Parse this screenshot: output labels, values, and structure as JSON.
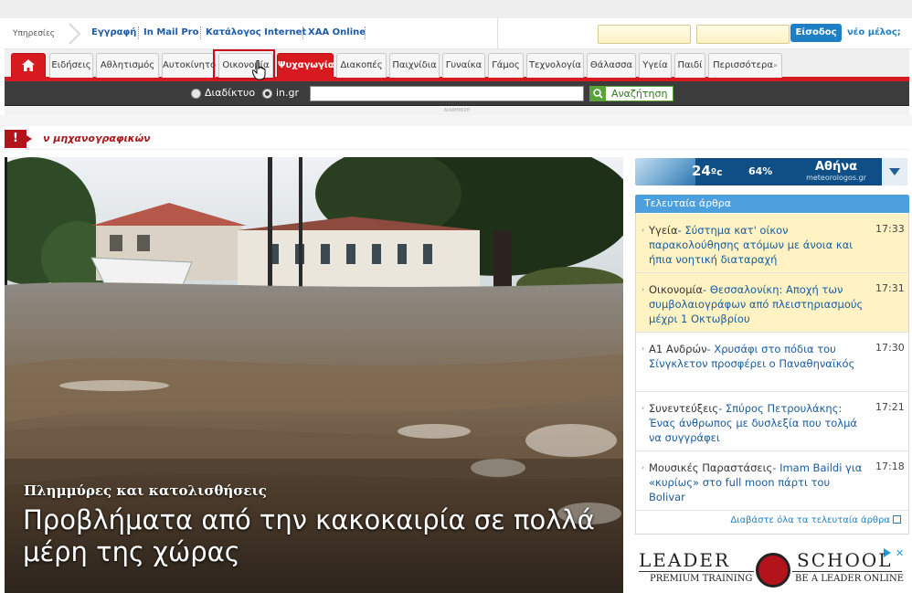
{
  "services_bar": {
    "label": "Υπηρεσίες",
    "links": [
      "Εγγραφή",
      "In Mail Pro",
      "Κατάλογος Internet",
      "ΧΑΑ Online"
    ],
    "login_label": "Είσοδος",
    "new_member_label": "νέο μέλος;"
  },
  "nav": {
    "home_icon": "home-icon",
    "tabs": [
      "Ειδήσεις",
      "Αθλητισμός",
      "Αυτοκίνητο",
      "Οικονομία",
      "Ψυχαγωγία",
      "Διακοπές",
      "Παιχνίδια",
      "Γυναίκα",
      "Γάμος",
      "Τεχνολογία",
      "Θάλασσα",
      "Υγεία",
      "Παιδί",
      "Περισσότερα"
    ],
    "active_tab": "Ψυχαγωγία",
    "hovered_tab": "Οικονομία",
    "more_glyph": "»",
    "accent_color": "#d71920"
  },
  "search": {
    "option_web": "Διαδίκτυο",
    "option_site": "in.gr",
    "selected": "in.gr",
    "value": "",
    "button_label": "Αναζήτηση"
  },
  "ad_strip_label": "ΔΙΑΦΗΜΙΣΗ",
  "ticker": {
    "icon": "!",
    "text": "ν μηχανογραφικών"
  },
  "hero": {
    "kicker": "Πλημμύρες και κατολισθήσεις",
    "headline": "Προβλήματα από την κακοκαιρία σε πολλά μέρη της χώρας"
  },
  "weather": {
    "temperature": "24",
    "unit": "ºc",
    "humidity": "64%",
    "city": "Αθήνα",
    "source": "meteorologos.gr"
  },
  "latest": {
    "header": "Τελευταία άρθρα",
    "items": [
      {
        "category": "Υγεία",
        "title": "Σύστημα κατ' οίκον παρακολούθησης ατόμων με άνοια και ήπια νοητική διαταραχή",
        "time": "17:33"
      },
      {
        "category": "Οικονομία",
        "title": "Θεσσαλονίκη: Αποχή των συμβολαιογράφων από πλειστηριασμούς μέχρι 1 Οκτωβρίου",
        "time": "17:31"
      },
      {
        "category": "Α1 Ανδρών",
        "title": "Χρυσάφι στο πόδια του Σίνγκλετον προσφέρει ο Παναθηναϊκός",
        "time": "17:30"
      },
      {
        "category": "Συνεντεύξεις",
        "title": "Σπύρος Πετρουλάκης: Ένας άνθρωπος με δυσλεξία που τολμά να συγγράφει",
        "time": "17:21"
      },
      {
        "category": "Μουσικές Παραστάσεις",
        "title": "Imam Baildi για «κυρίως» στο full moon πάρτι του Bolivar",
        "time": "17:18"
      }
    ],
    "read_all": "Διαβάστε όλα τα τελευταία άρθρα"
  },
  "ad": {
    "word1": "LEADER",
    "word2": "SCHOOL",
    "tag1": "PREMIUM TRAINING",
    "tag2": "BE A LEADER ONLINE"
  }
}
